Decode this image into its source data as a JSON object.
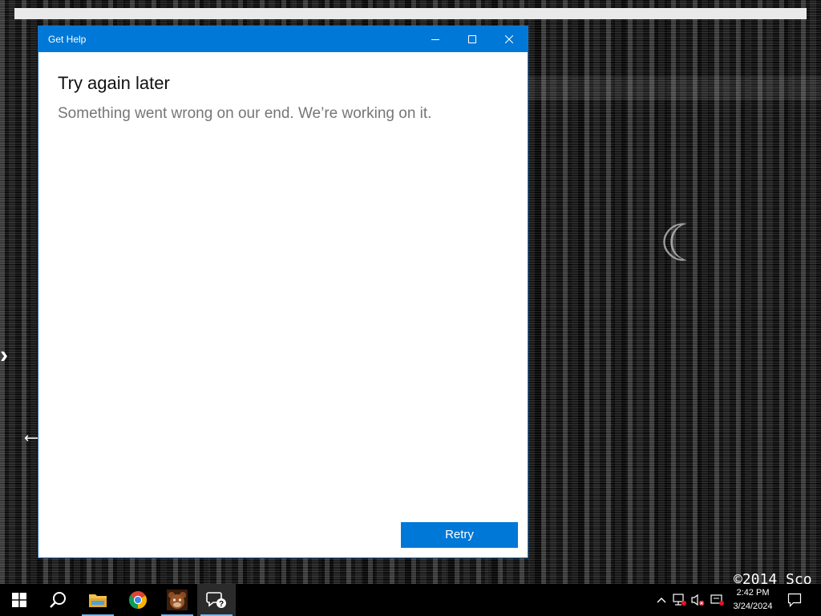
{
  "window": {
    "title": "Get Help",
    "heading": "Try again later",
    "message": "Something went wrong on our end. We’re working on it.",
    "retry_label": "Retry",
    "accent": "#0078d7"
  },
  "desktop": {
    "watermark": "©2014 Sco"
  },
  "taskbar": {
    "apps": [
      {
        "name": "start",
        "icon": "windows-logo-icon"
      },
      {
        "name": "search",
        "icon": "search-icon"
      },
      {
        "name": "file-explorer",
        "icon": "folder-icon"
      },
      {
        "name": "chrome",
        "icon": "chrome-icon"
      },
      {
        "name": "fnaf",
        "icon": "freddy-icon"
      },
      {
        "name": "get-help",
        "icon": "get-help-icon"
      }
    ],
    "clock": {
      "time": "2:42 PM",
      "date": "3/24/2024"
    }
  }
}
